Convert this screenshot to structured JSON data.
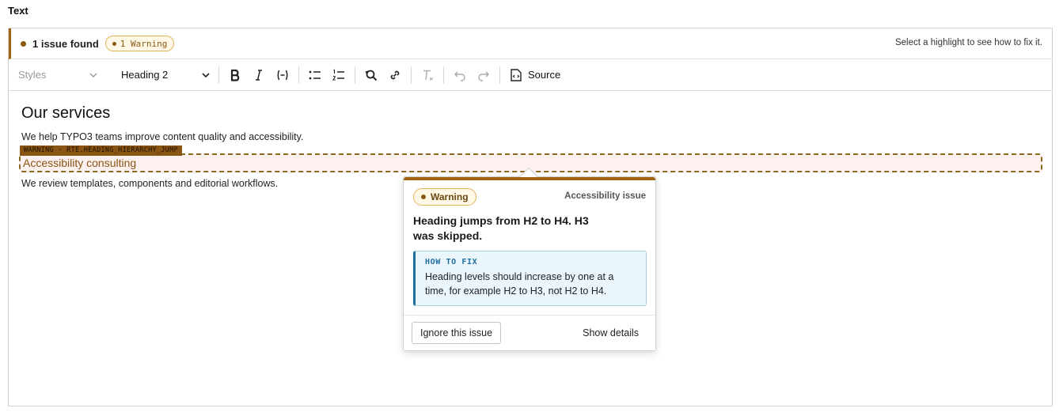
{
  "field": {
    "label": "Text"
  },
  "issues": {
    "summary": "1 issue found",
    "badge": "1 Warning",
    "hint": "Select a highlight to see how to fix it.",
    "accent_color": "#a06413"
  },
  "toolbar": {
    "styles_placeholder": "Styles",
    "heading_value": "Heading 2",
    "source_label": "Source",
    "buttons": [
      "bold-icon",
      "italic-icon",
      "code-icon",
      "bulleted-list-icon",
      "numbered-list-icon",
      "find-replace-icon",
      "link-icon",
      "remove-format-icon",
      "undo-icon",
      "redo-icon",
      "source-icon"
    ]
  },
  "content": {
    "heading": "Our services",
    "paragraph1": "We help TYPO3 teams improve content quality and accessibility.",
    "flag_label": "WARNING · RTE.HEADING_HIERARCHY_JUMP",
    "flagged_heading": "Accessibility consulting",
    "paragraph2": "We review templates, components and editorial workflows."
  },
  "popover": {
    "severity": "Warning",
    "category": "Accessibility issue",
    "title": "Heading jumps from H2 to H4. H3 was skipped.",
    "fix_label": "HOW TO FIX",
    "fix_text": "Heading levels should increase by one at a time, for example H2 to H3, not H2 to H4.",
    "ignore_label": "Ignore this issue",
    "details_label": "Show details"
  }
}
